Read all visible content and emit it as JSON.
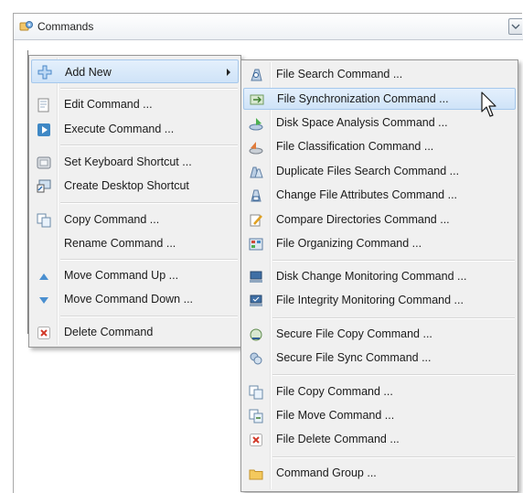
{
  "panel": {
    "title": "Commands"
  },
  "main_menu": {
    "add_new": "Add New",
    "edit": "Edit Command ...",
    "execute": "Execute Command ...",
    "shortcut": "Set Keyboard Shortcut ...",
    "desktop": "Create Desktop Shortcut",
    "copy": "Copy Command ...",
    "rename": "Rename Command ...",
    "move_up": "Move Command Up ...",
    "move_down": "Move Command Down ...",
    "delete": "Delete Command"
  },
  "submenu": [
    "File Search Command ...",
    "File Synchronization Command ...",
    "Disk Space Analysis Command ...",
    "File Classification Command ...",
    "Duplicate Files Search Command ...",
    "Change File Attributes Command ...",
    "Compare Directories Command ...",
    "File Organizing Command ...",
    "Disk Change Monitoring Command ...",
    "File Integrity Monitoring Command ...",
    "Secure File Copy Command ...",
    "Secure File Sync Command ...",
    "File Copy Command ...",
    "File Move Command ...",
    "File Delete Command ...",
    "Command Group ..."
  ],
  "icons": {
    "header": "commands-icon",
    "add_new": "plus-icon",
    "edit": "edit-icon",
    "execute": "play-icon",
    "shortcut": "keyboard-icon",
    "desktop": "desktop-shortcut-icon",
    "copy": "copy-icon",
    "move_up": "triangle-up-icon",
    "move_down": "triangle-down-icon",
    "delete": "delete-icon"
  },
  "colors": {
    "highlight": "#cfe3f8",
    "menu_bg": "#f0f0f0",
    "accent_blue": "#3f88c5"
  }
}
